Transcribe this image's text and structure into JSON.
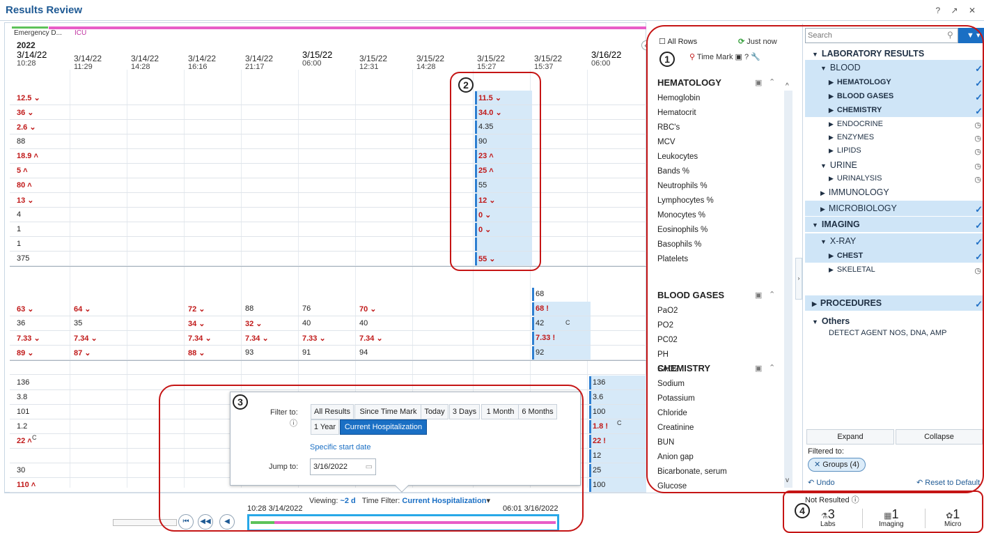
{
  "window": {
    "title": "Results Review",
    "icons": "? ↗ ✕"
  },
  "encounters": {
    "ed": "Emergency D...",
    "icu": "ICU"
  },
  "year": "2022",
  "dates": [
    {
      "d": "3/14/22",
      "t": "10:28"
    },
    {
      "d": "3/14/22",
      "t": "11:29"
    },
    {
      "d": "3/14/22",
      "t": "14:28"
    },
    {
      "d": "3/14/22",
      "t": "16:16"
    },
    {
      "d": "3/14/22",
      "t": "21:17"
    },
    {
      "d": "3/15/22",
      "t": "06:00"
    },
    {
      "d": "3/15/22",
      "t": "12:31"
    },
    {
      "d": "3/15/22",
      "t": "14:28"
    },
    {
      "d": "3/15/22",
      "t": "15:27"
    },
    {
      "d": "3/15/22",
      "t": "15:37"
    },
    {
      "d": "3/16/22",
      "t": "06:00"
    }
  ],
  "flags": {
    "low": "⌄",
    "high": "˄",
    "crit": "!",
    "c": "C"
  },
  "hem": {
    "col0": [
      "12.5 ⌄",
      "36 ⌄",
      "2.6 ⌄",
      "88",
      "18.9 ˄",
      "5 ˄",
      "80 ˄",
      "13 ⌄",
      "4",
      "1",
      "1",
      "375"
    ],
    "col8": [
      "11.5 ⌄",
      "34.0 ⌄",
      "4.35",
      "90",
      "23 ˄",
      "25 ˄",
      "55",
      "12 ⌄",
      "0 ⌄",
      "0 ⌄",
      "",
      "55 ⌄"
    ]
  },
  "gases": {
    "c0": [
      "",
      "63 ⌄",
      "36",
      "7.33 ⌄",
      "89 ⌄"
    ],
    "c1": [
      "",
      "64 ⌄",
      "35",
      "7.34 ⌄",
      "87 ⌄"
    ],
    "c3": [
      "",
      "72 ⌄",
      "34 ⌄",
      "7.34 ⌄",
      "88 ⌄"
    ],
    "c4": [
      "",
      "88",
      "32 ⌄",
      "7.34 ⌄",
      "93"
    ],
    "c5": [
      "",
      "76",
      "40",
      "7.33 ⌄",
      "91"
    ],
    "c6": [
      "",
      "70 ⌄",
      "40",
      "7.34 ⌄",
      "94"
    ],
    "c9": [
      "68",
      "68 !",
      "42",
      "7.33 !",
      "92"
    ]
  },
  "chem": {
    "c0": [
      "136",
      "3.8",
      "101",
      "1.2",
      "22 ˄",
      "",
      "30",
      "110 ˄"
    ],
    "c10": [
      "136",
      "3.6",
      "100",
      "1.8 !",
      "22 !",
      "12",
      "25",
      "100"
    ]
  },
  "labels": {
    "hematology": "HEMATOLOGY",
    "hem_rows": [
      "Hemoglobin",
      "Hematocrit",
      "RBC's",
      "MCV",
      "Leukocytes",
      "Bands %",
      "Neutrophils %",
      "Lymphocytes %",
      "Monocytes %",
      "Eosinophils %",
      "Basophils %",
      "Platelets"
    ],
    "gases": "BLOOD GASES",
    "gas_rows": [
      "PaO2",
      "PO2",
      "PC02",
      "PH",
      "SAO2"
    ],
    "chemistry": "CHEMISTRY",
    "chem_rows": [
      "Sodium",
      "Potassium",
      "Chloride",
      "Creatinine",
      "BUN",
      "Anion gap",
      "Bicarbonate, serum",
      "Glucose"
    ]
  },
  "toolbar": {
    "all_rows": "All Rows",
    "just_now": "Just now",
    "time_mark": "Time Mark"
  },
  "search": {
    "placeholder": "Search"
  },
  "tree": [
    {
      "label": "LABORATORY RESULTS",
      "lvl": 0,
      "bold": true,
      "sel": false,
      "mark": ""
    },
    {
      "label": "BLOOD",
      "lvl": 1,
      "bold": false,
      "sel": true,
      "mark": "check"
    },
    {
      "label": "HEMATOLOGY",
      "lvl": 2,
      "bold": true,
      "sel": true,
      "mark": "check"
    },
    {
      "label": "BLOOD GASES",
      "lvl": 2,
      "bold": true,
      "sel": true,
      "mark": "check"
    },
    {
      "label": "CHEMISTRY",
      "lvl": 2,
      "bold": true,
      "sel": true,
      "mark": "check"
    },
    {
      "label": "ENDOCRINE",
      "lvl": 2,
      "bold": false,
      "sel": false,
      "mark": "clock"
    },
    {
      "label": "ENZYMES",
      "lvl": 2,
      "bold": false,
      "sel": false,
      "mark": "clock"
    },
    {
      "label": "LIPIDS",
      "lvl": 2,
      "bold": false,
      "sel": false,
      "mark": "clock"
    },
    {
      "label": "URINE",
      "lvl": 1,
      "bold": false,
      "sel": false,
      "mark": "clock"
    },
    {
      "label": "URINALYSIS",
      "lvl": 2,
      "bold": false,
      "sel": false,
      "mark": "clock"
    },
    {
      "label": "IMMUNOLOGY",
      "lvl": 1,
      "bold": false,
      "sel": false,
      "mark": ""
    },
    {
      "label": "MICROBIOLOGY",
      "lvl": 1,
      "bold": false,
      "sel": true,
      "mark": "check"
    },
    {
      "label": "IMAGING",
      "lvl": 0,
      "bold": true,
      "sel": true,
      "mark": "check"
    },
    {
      "label": "X-RAY",
      "lvl": 1,
      "bold": false,
      "sel": true,
      "mark": "check"
    },
    {
      "label": "CHEST",
      "lvl": 2,
      "bold": true,
      "sel": true,
      "mark": "check"
    },
    {
      "label": "SKELETAL",
      "lvl": 2,
      "bold": false,
      "sel": false,
      "mark": "clock"
    },
    {
      "label": "PROCEDURES",
      "lvl": 0,
      "bold": true,
      "sel": true,
      "mark": "check"
    },
    {
      "label": "Others",
      "lvl": 0,
      "bold": true,
      "sel": false,
      "mark": ""
    },
    {
      "label": "DETECT AGENT NOS, DNA, AMP",
      "lvl": 3,
      "bold": false,
      "sel": false,
      "mark": ""
    }
  ],
  "panel": {
    "expand": "Expand",
    "collapse": "Collapse",
    "filtered_to": "Filtered to:",
    "groups": "Groups (4)",
    "undo": "Undo",
    "reset": "Reset to Default"
  },
  "popup": {
    "filter_to": "Filter to:",
    "buttons": [
      "All Results",
      "Since Time Mark",
      "Today",
      "3 Days",
      "1 Month",
      "6 Months",
      "1 Year",
      "Current Hospitalization"
    ],
    "specific": "Specific start date",
    "jump_to": "Jump to:",
    "jump_value": "3/16/2022"
  },
  "timeline": {
    "viewing_label": "Viewing:",
    "viewing_value": "~2 d",
    "filter_label": "Time Filter:",
    "filter_value": "Current Hospitalization",
    "start": "10:28 3/14/2022",
    "end": "06:01 3/16/2022"
  },
  "not_resulted": {
    "title": "Not Resulted",
    "labs_n": "3",
    "labs": "Labs",
    "imaging_n": "1",
    "imaging": "Imaging",
    "micro_n": "1",
    "micro": "Micro"
  },
  "callouts": [
    "1",
    "2",
    "3",
    "4"
  ],
  "colors": {
    "accent": "#1a6fc4",
    "critical": "#c01818",
    "highlight": "#d6e9f8"
  }
}
